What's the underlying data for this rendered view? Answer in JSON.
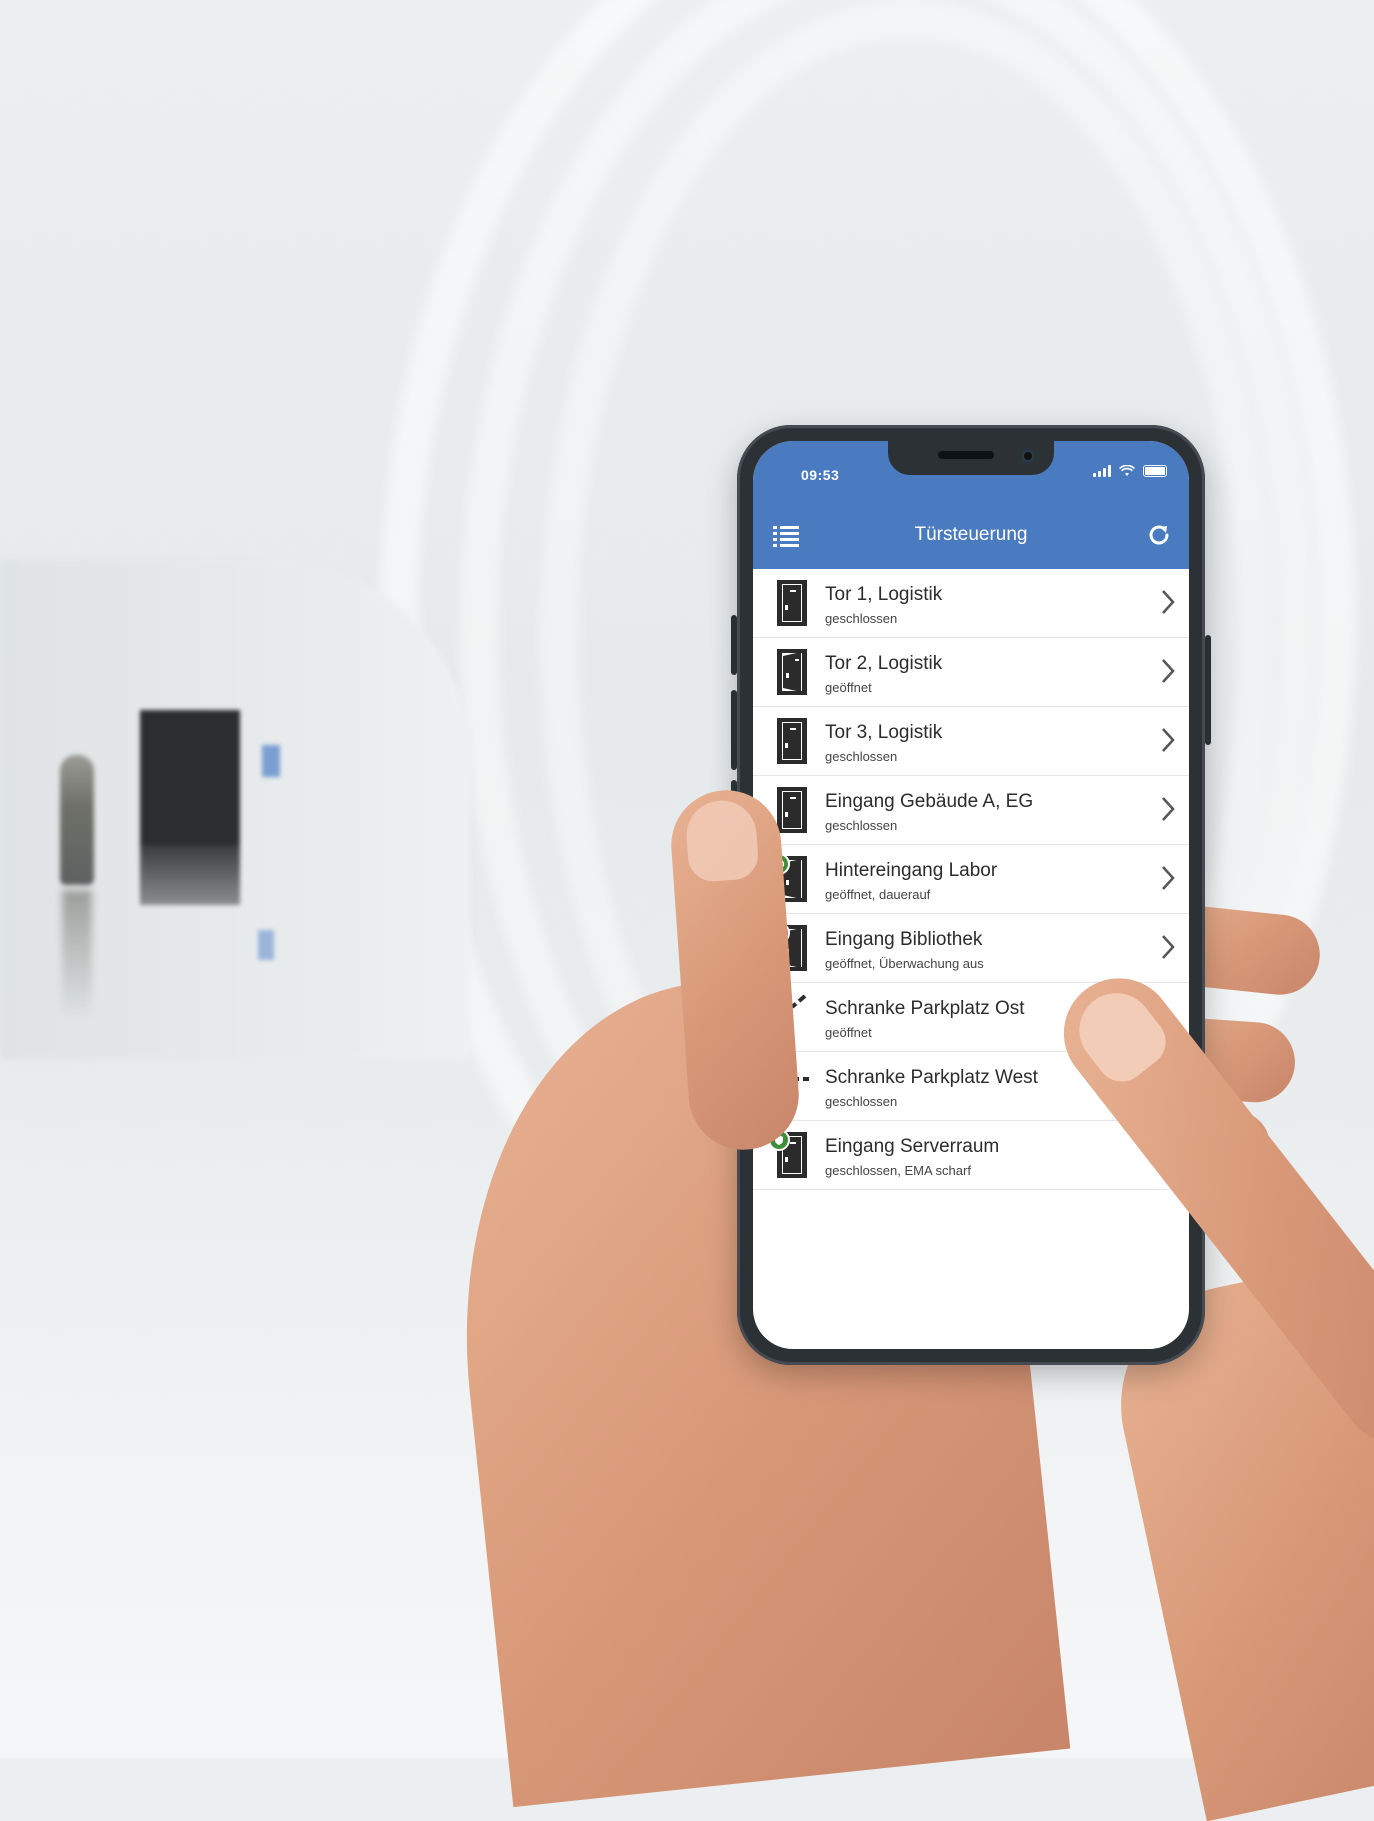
{
  "status_bar": {
    "time": "09:53"
  },
  "header": {
    "title": "Türsteuerung",
    "menu_icon": "list-icon",
    "refresh_icon": "refresh-icon"
  },
  "colors": {
    "brand": "#4a7bc1",
    "badge_green": "#3f8f3a",
    "badge_red": "#c0292b"
  },
  "doors": [
    {
      "name": "Tor 1, Logistik",
      "status": "geschlossen",
      "icon": "door-closed-icon"
    },
    {
      "name": "Tor 2, Logistik",
      "status": "geöffnet",
      "icon": "door-open-icon"
    },
    {
      "name": "Tor 3, Logistik",
      "status": "geschlossen",
      "icon": "door-closed-icon"
    },
    {
      "name": "Eingang Gebäude A, EG",
      "status": "geschlossen",
      "icon": "door-closed-icon"
    },
    {
      "name": "Hintereingang Labor",
      "status": "geöffnet, dauerauf",
      "icon": "door-open-clock-icon"
    },
    {
      "name": "Eingang Bibliothek",
      "status": "geöffnet, Überwachung aus",
      "icon": "door-open-eye-icon"
    },
    {
      "name": "Schranke Parkplatz Ost",
      "status": "geöffnet",
      "icon": "barrier-open-icon"
    },
    {
      "name": "Schranke Parkplatz West",
      "status": "geschlossen",
      "icon": "barrier-closed-icon"
    },
    {
      "name": "Eingang Serverraum",
      "status": "geschlossen, EMA scharf",
      "icon": "door-closed-shield-icon"
    }
  ]
}
